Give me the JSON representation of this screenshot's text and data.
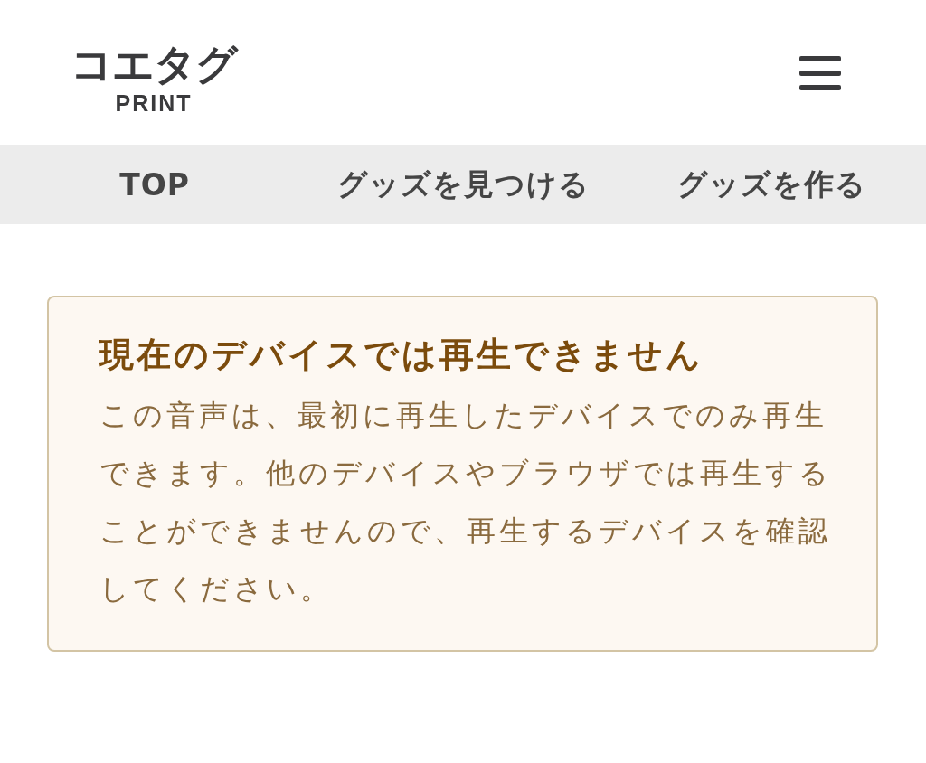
{
  "header": {
    "logo": {
      "title": "コエタグ",
      "subtitle": "PRINT"
    }
  },
  "nav": {
    "items": [
      {
        "label": "TOP"
      },
      {
        "label": "グッズを見つける"
      },
      {
        "label": "グッズを作る"
      }
    ]
  },
  "notice": {
    "title": "現在のデバイスでは再生できません",
    "body": "この音声は、最初に再生したデバイスでのみ再生できます。他のデバイスやブラウザでは再生することができませんので、再生するデバイスを確認してください。"
  }
}
